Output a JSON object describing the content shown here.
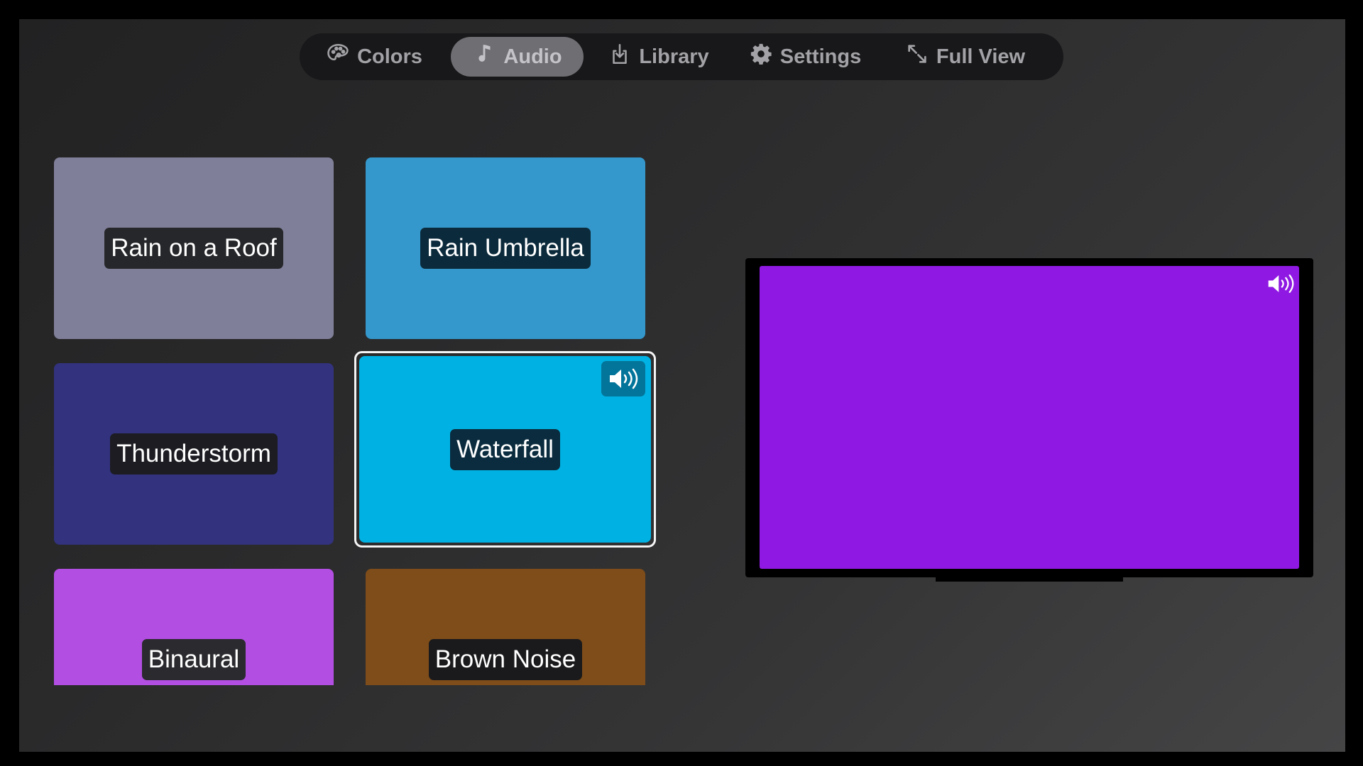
{
  "nav": {
    "items": [
      {
        "label": "Colors",
        "icon": "palette-icon",
        "active": false
      },
      {
        "label": "Audio",
        "icon": "music-note-icon",
        "active": true
      },
      {
        "label": "Library",
        "icon": "download-tray-icon",
        "active": false
      },
      {
        "label": "Settings",
        "icon": "gear-icon",
        "active": false
      },
      {
        "label": "Full View",
        "icon": "expand-arrows-icon",
        "active": false
      }
    ]
  },
  "tiles": [
    {
      "label": "Rain on a Roof",
      "color": "#807f99",
      "label_bg": "#26272a"
    },
    {
      "label": "Rain Umbrella",
      "color": "#3498cc",
      "label_bg": "#0b2a3b"
    },
    {
      "label": "Thunderstorm",
      "color": "#32327e",
      "label_bg": "#1c1c22"
    },
    {
      "label": "Waterfall",
      "color": "#00b2e3",
      "label_bg": "#0a2c3e",
      "selected": true,
      "playing_icon": "speaker-volume-icon"
    },
    {
      "label": "Binaural",
      "color": "#b34ee3",
      "label_bg": "#2b2b2f"
    },
    {
      "label": "Brown Noise",
      "color": "#7f4d19",
      "label_bg": "#1a1a1c"
    }
  ],
  "preview": {
    "screen_color": "#8f19e3",
    "icon": "speaker-volume-icon"
  }
}
